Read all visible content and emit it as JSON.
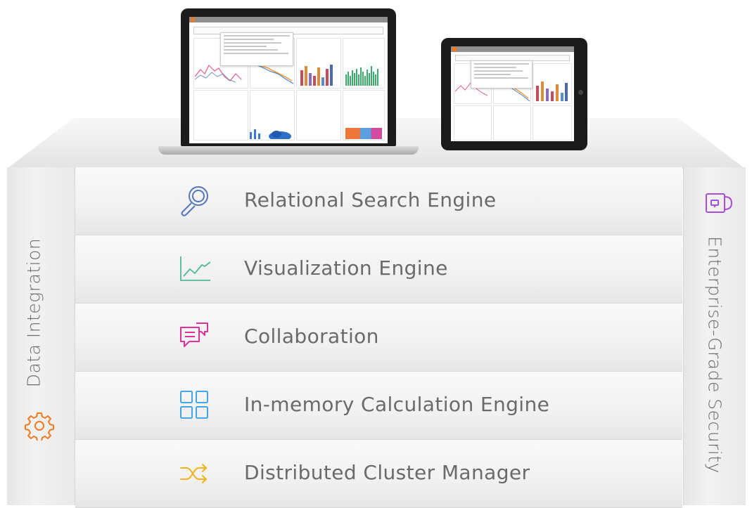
{
  "layers": [
    {
      "label": "Relational Search Engine",
      "icon": "magnifier-icon",
      "color": "#5577b8"
    },
    {
      "label": "Visualization Engine",
      "icon": "line-chart-icon",
      "color": "#4fb89a"
    },
    {
      "label": "Collaboration",
      "icon": "chat-bubbles-icon",
      "color": "#e0319a"
    },
    {
      "label": "In-memory Calculation Engine",
      "icon": "grid-icon",
      "color": "#45a6e6"
    },
    {
      "label": "Distributed Cluster Manager",
      "icon": "shuffle-icon",
      "color": "#f2b21c"
    }
  ],
  "left_pillar": {
    "label": "Data Integration",
    "icon": "gear-icon",
    "color": "#f47a20"
  },
  "right_pillar": {
    "label": "Enterprise-Grade Security",
    "icon": "lock-icon",
    "color": "#a84ed6"
  }
}
